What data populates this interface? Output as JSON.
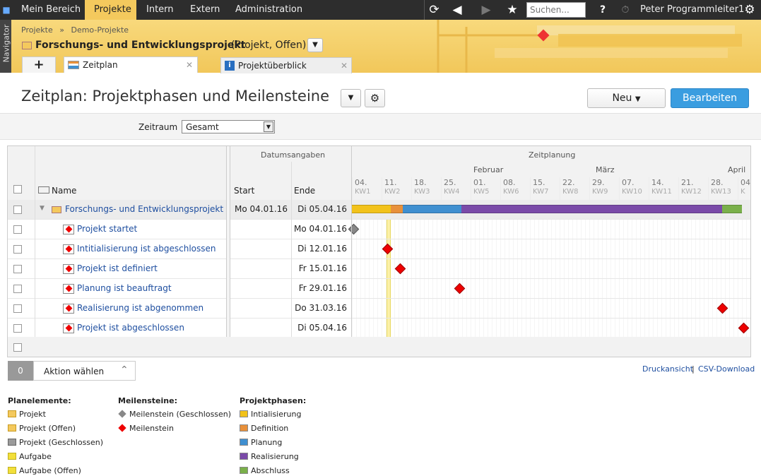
{
  "topbar": {
    "nav": [
      "Mein Bereich",
      "Projekte",
      "Intern",
      "Extern",
      "Administration"
    ],
    "search_placeholder": "Suchen...",
    "help": "?",
    "user": "Peter Programmleiter1"
  },
  "header": {
    "navigator_label": "Navigator",
    "breadcrumb": [
      "Projekte",
      "»",
      "Demo-Projekte"
    ],
    "project_title": "Forschungs- und Entwicklungsprojekt",
    "project_meta": "(Projekt, Offen)",
    "tabs": [
      {
        "label": "Zeitplan"
      },
      {
        "label": "Projektüberblick"
      }
    ],
    "add_tab": "+"
  },
  "page": {
    "title": "Zeitplan: Projektphasen und Meilensteine",
    "new_button": "Neu",
    "edit_button": "Bearbeiten",
    "zeitraum_label": "Zeitraum",
    "zeitraum_value": "Gesamt"
  },
  "grid": {
    "group_dates": "Datumsangaben",
    "group_plan": "Zeitplanung",
    "col_name": "Name",
    "col_start": "Start",
    "col_end": "Ende",
    "months": [
      "Februar",
      "März",
      "April"
    ],
    "weeks": [
      {
        "day": "04.",
        "kw": "KW1"
      },
      {
        "day": "11.",
        "kw": "KW2"
      },
      {
        "day": "18.",
        "kw": "KW3"
      },
      {
        "day": "25.",
        "kw": "KW4"
      },
      {
        "day": "01.",
        "kw": "KW5"
      },
      {
        "day": "08.",
        "kw": "KW6"
      },
      {
        "day": "15.",
        "kw": "KW7"
      },
      {
        "day": "22.",
        "kw": "KW8"
      },
      {
        "day": "29.",
        "kw": "KW9"
      },
      {
        "day": "07.",
        "kw": "KW10"
      },
      {
        "day": "14.",
        "kw": "KW11"
      },
      {
        "day": "21.",
        "kw": "KW12"
      },
      {
        "day": "28.",
        "kw": "KW13"
      },
      {
        "day": "04",
        "kw": "K"
      }
    ],
    "rows": [
      {
        "name": "Forschungs- und Entwicklungsprojekt",
        "start": "Mo 04.01.16",
        "end": "Di 05.04.16",
        "type": "project"
      },
      {
        "name": "Projekt startet",
        "start": "",
        "end": "Mo 04.01.16",
        "type": "milestone-closed"
      },
      {
        "name": "Intitialisierung ist abgeschlossen",
        "start": "",
        "end": "Di 12.01.16",
        "type": "milestone"
      },
      {
        "name": "Projekt ist definiert",
        "start": "",
        "end": "Fr 15.01.16",
        "type": "milestone"
      },
      {
        "name": "Planung ist beauftragt",
        "start": "",
        "end": "Fr 29.01.16",
        "type": "milestone"
      },
      {
        "name": "Realisierung ist abgenommen",
        "start": "",
        "end": "Do 31.03.16",
        "type": "milestone"
      },
      {
        "name": "Projekt ist abgeschlossen",
        "start": "",
        "end": "Di 05.04.16",
        "type": "milestone"
      }
    ]
  },
  "footer": {
    "count": "0",
    "action": "Aktion wählen",
    "print": "Druckansicht",
    "sep": "|",
    "csv": "CSV-Download"
  },
  "legend": {
    "plan_title": "Planelemente:",
    "plan_items": [
      "Projekt",
      "Projekt (Offen)",
      "Projekt (Geschlossen)",
      "Aufgabe",
      "Aufgabe (Offen)"
    ],
    "ms_title": "Meilensteine:",
    "ms_items": [
      "Meilenstein (Geschlossen)",
      "Meilenstein"
    ],
    "phase_title": "Projektphasen:",
    "phase_items": [
      "Intialisierung",
      "Definition",
      "Planung",
      "Realisierung",
      "Abschluss"
    ]
  },
  "colors": {
    "accent": "#f4c95d",
    "button_blue": "#3a9de0",
    "phase_init": "#f2c21a",
    "phase_def": "#e8903a",
    "phase_plan": "#3f8fd0",
    "phase_real": "#7a4aa8",
    "phase_close": "#7ab04a"
  }
}
